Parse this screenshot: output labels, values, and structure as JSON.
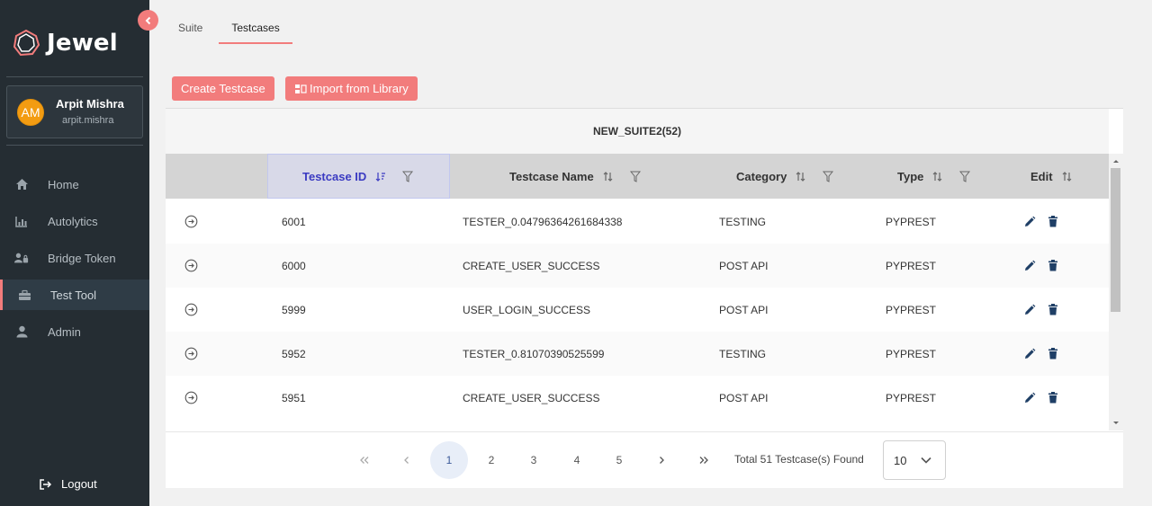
{
  "app": {
    "name": "Jewel"
  },
  "user": {
    "initials": "AM",
    "name": "Arpit Mishra",
    "handle": "arpit.mishra"
  },
  "sidebar": {
    "items": [
      {
        "label": "Home",
        "icon": "home-icon"
      },
      {
        "label": "Autolytics",
        "icon": "chart-icon"
      },
      {
        "label": "Bridge Token",
        "icon": "users-lock-icon"
      },
      {
        "label": "Test Tool",
        "icon": "toolbox-icon",
        "active": true
      },
      {
        "label": "Admin",
        "icon": "user-icon"
      }
    ],
    "logout": "Logout"
  },
  "tabs": [
    {
      "label": "Suite"
    },
    {
      "label": "Testcases",
      "active": true
    }
  ],
  "toolbar": {
    "create_label": "Create Testcase",
    "import_label": "Import from Library"
  },
  "table": {
    "title": "NEW_SUITE2(52)",
    "columns": [
      "Testcase ID",
      "Testcase Name",
      "Category",
      "Type",
      "Edit"
    ],
    "rows": [
      {
        "id": "6001",
        "name": "TESTER_0.04796364261684338",
        "category": "TESTING",
        "type": "PYPREST"
      },
      {
        "id": "6000",
        "name": "CREATE_USER_SUCCESS",
        "category": "POST API",
        "type": "PYPREST"
      },
      {
        "id": "5999",
        "name": "USER_LOGIN_SUCCESS",
        "category": "POST API",
        "type": "PYPREST"
      },
      {
        "id": "5952",
        "name": "TESTER_0.81070390525599",
        "category": "TESTING",
        "type": "PYPREST"
      },
      {
        "id": "5951",
        "name": "CREATE_USER_SUCCESS",
        "category": "POST API",
        "type": "PYPREST"
      }
    ]
  },
  "pagination": {
    "pages": [
      "1",
      "2",
      "3",
      "4",
      "5"
    ],
    "current": "1",
    "total_text": "Total 51 Testcase(s) Found",
    "per_page": "10"
  },
  "colors": {
    "accent": "#f27c7c",
    "sidebar_bg": "#252d33",
    "edit_icon": "#1f3f66"
  }
}
